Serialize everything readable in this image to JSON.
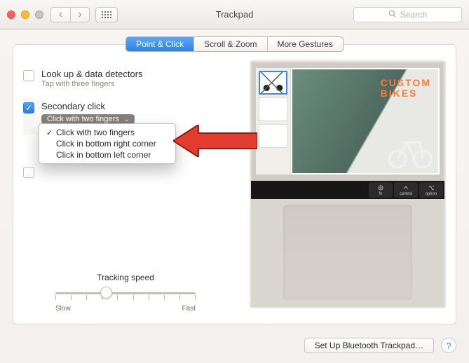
{
  "window": {
    "title": "Trackpad"
  },
  "search": {
    "placeholder": "Search"
  },
  "tabs": {
    "point_click": "Point & Click",
    "scroll_zoom": "Scroll & Zoom",
    "more_gestures": "More Gestures"
  },
  "options": {
    "lookup": {
      "title": "Look up & data detectors",
      "subtitle": "Tap with three fingers"
    },
    "secondary": {
      "title": "Secondary click",
      "popup_label": "Click with two fingers"
    }
  },
  "popup_caret": "⌄",
  "menu": {
    "items": [
      {
        "checked": true,
        "label": "Click with two fingers"
      },
      {
        "checked": false,
        "label": "Click in bottom right corner"
      },
      {
        "checked": false,
        "label": "Click in bottom left corner"
      }
    ]
  },
  "tracking": {
    "label": "Tracking speed",
    "slow": "Slow",
    "fast": "Fast"
  },
  "preview": {
    "headline_a": "CUSTOM",
    "headline_b": "BIKES",
    "keys": [
      "fn",
      "control",
      "option"
    ]
  },
  "footer": {
    "bt_button": "Set Up Bluetooth Trackpad…",
    "help": "?"
  },
  "glyphs": {
    "check": "✓",
    "back": "‹",
    "fwd": "›",
    "search": "🔍"
  }
}
